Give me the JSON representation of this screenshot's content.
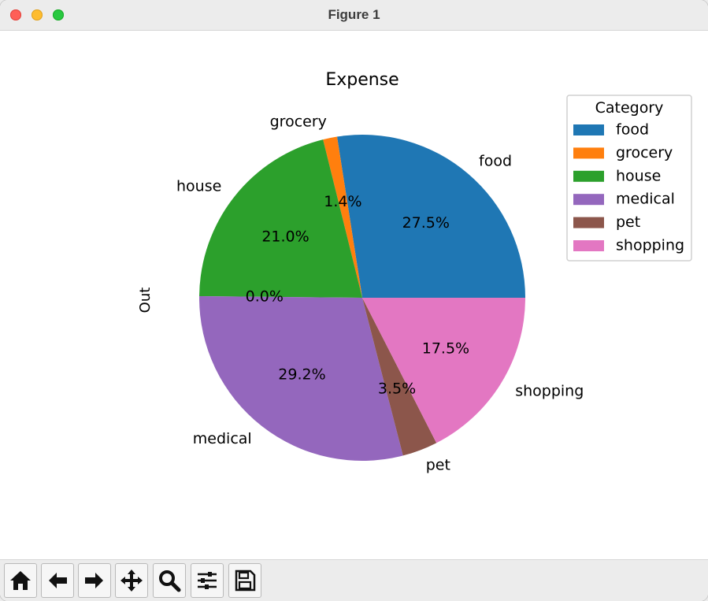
{
  "window": {
    "title": "Figure 1"
  },
  "toolbar": {
    "buttons": [
      {
        "name": "home-button",
        "icon": "home-icon"
      },
      {
        "name": "back-button",
        "icon": "arrow-left-icon"
      },
      {
        "name": "forward-button",
        "icon": "arrow-right-icon"
      },
      {
        "name": "pan-button",
        "icon": "move-icon"
      },
      {
        "name": "zoom-button",
        "icon": "magnifier-icon"
      },
      {
        "name": "configure-subplots-button",
        "icon": "sliders-icon"
      },
      {
        "name": "save-button",
        "icon": "floppy-disk-icon"
      }
    ]
  },
  "chart_data": {
    "type": "pie",
    "title": "Expense",
    "ylabel": "Out",
    "categories": [
      "food",
      "grocery",
      "house",
      "medical",
      "pet",
      "shopping"
    ],
    "values": [
      27.5,
      1.4,
      21.0,
      0.0,
      29.2,
      3.5,
      17.5
    ],
    "slices": [
      {
        "label": "food",
        "value": 27.5,
        "pct_label": "27.5%",
        "color": "#1f77b4",
        "show_label": true
      },
      {
        "label": "grocery",
        "value": 1.4,
        "pct_label": "1.4%",
        "color": "#ff7f0e",
        "show_label": true
      },
      {
        "label": "house",
        "value": 21.0,
        "pct_label": "21.0%",
        "color": "#2ca02c",
        "show_label": true
      },
      {
        "label": "",
        "value": 0.0,
        "pct_label": "0.0%",
        "color": "#d62728",
        "show_label": false
      },
      {
        "label": "medical",
        "value": 29.2,
        "pct_label": "29.2%",
        "color": "#9467bd",
        "show_label": true
      },
      {
        "label": "pet",
        "value": 3.5,
        "pct_label": "3.5%",
        "color": "#8c564b",
        "show_label": true
      },
      {
        "label": "shopping",
        "value": 17.5,
        "pct_label": "17.5%",
        "color": "#e377c2",
        "show_label": true
      }
    ],
    "start_angle_deg": 0,
    "direction": "counterclockwise",
    "legend": {
      "title": "Category",
      "placement": "upper-right",
      "entries": [
        {
          "label": "food",
          "color": "#1f77b4"
        },
        {
          "label": "grocery",
          "color": "#ff7f0e"
        },
        {
          "label": "house",
          "color": "#2ca02c"
        },
        {
          "label": "medical",
          "color": "#9467bd"
        },
        {
          "label": "pet",
          "color": "#8c564b"
        },
        {
          "label": "shopping",
          "color": "#e377c2"
        }
      ]
    }
  }
}
